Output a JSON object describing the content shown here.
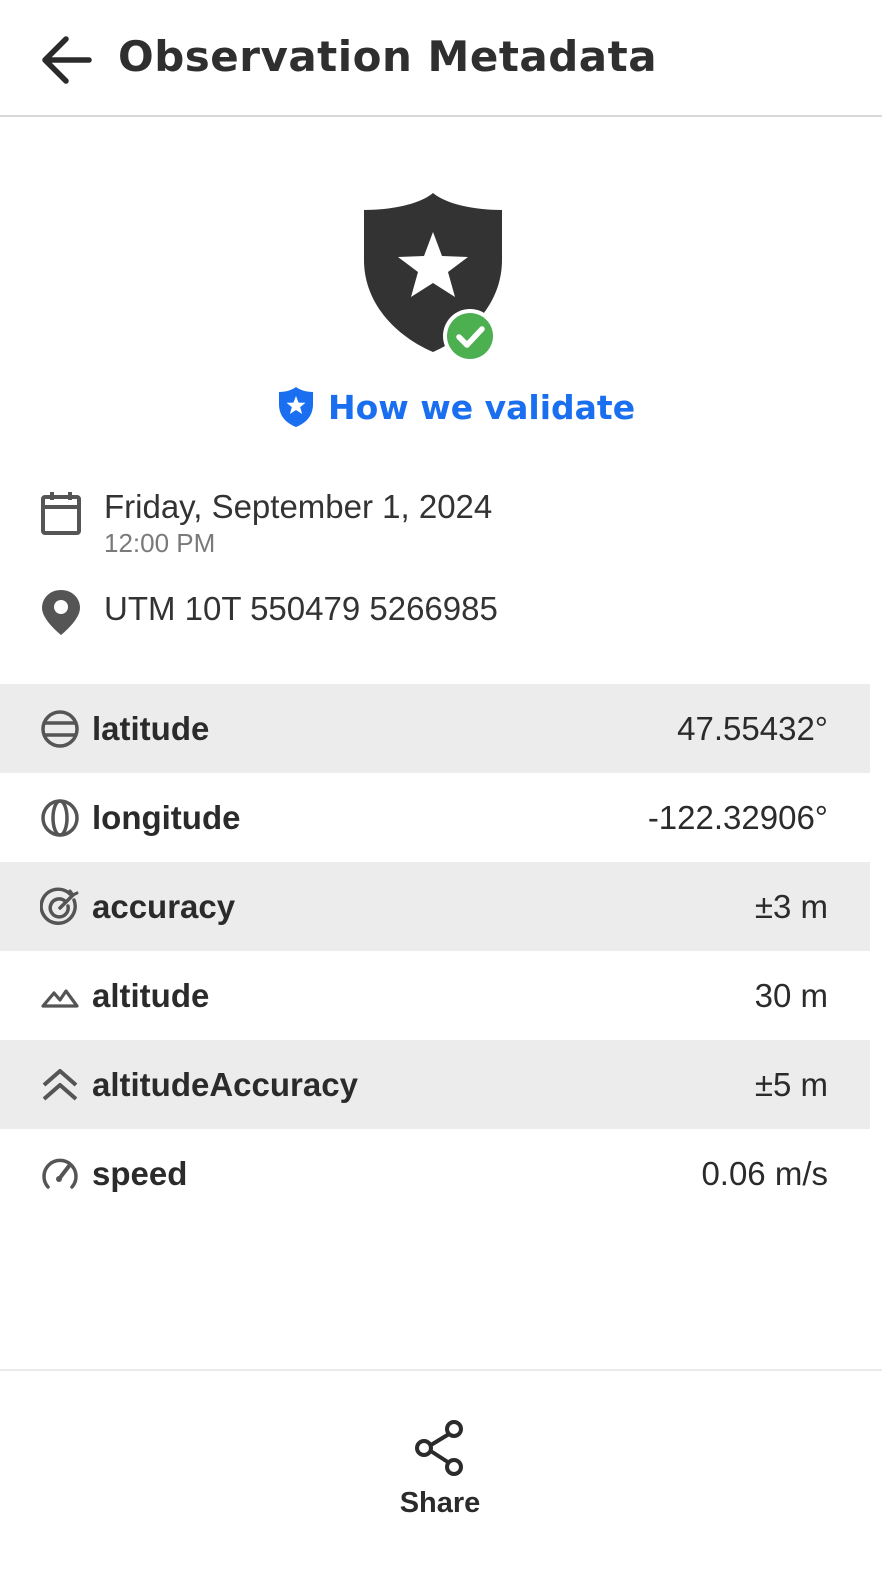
{
  "header": {
    "title": "Observation Metadata",
    "back_icon": "arrow-left-icon"
  },
  "validation": {
    "badge_icon": "shield-star-check-icon",
    "link_icon": "shield-star-icon",
    "link_label": "How we validate",
    "link_color": "#1a6ef0",
    "check_color": "#4caf50"
  },
  "observation": {
    "date": "Friday,  September 1, 2024",
    "time": "12:00 PM",
    "location": "UTM 10T 550479 5266985"
  },
  "metadata": [
    {
      "icon": "latitude-globe-icon",
      "label": "latitude",
      "value": "47.55432°"
    },
    {
      "icon": "longitude-globe-icon",
      "label": "longitude",
      "value": "-122.32906°"
    },
    {
      "icon": "accuracy-target-icon",
      "label": "accuracy",
      "value": "±3 m"
    },
    {
      "icon": "altitude-mountain-icon",
      "label": "altitude",
      "value": "30 m"
    },
    {
      "icon": "altitude-accuracy-chevrons-icon",
      "label": "altitudeAccuracy",
      "value": "±5 m"
    },
    {
      "icon": "speedometer-icon",
      "label": "speed",
      "value": "0.06 m/s"
    }
  ],
  "footer": {
    "share_label": "Share",
    "share_icon": "share-icon"
  }
}
